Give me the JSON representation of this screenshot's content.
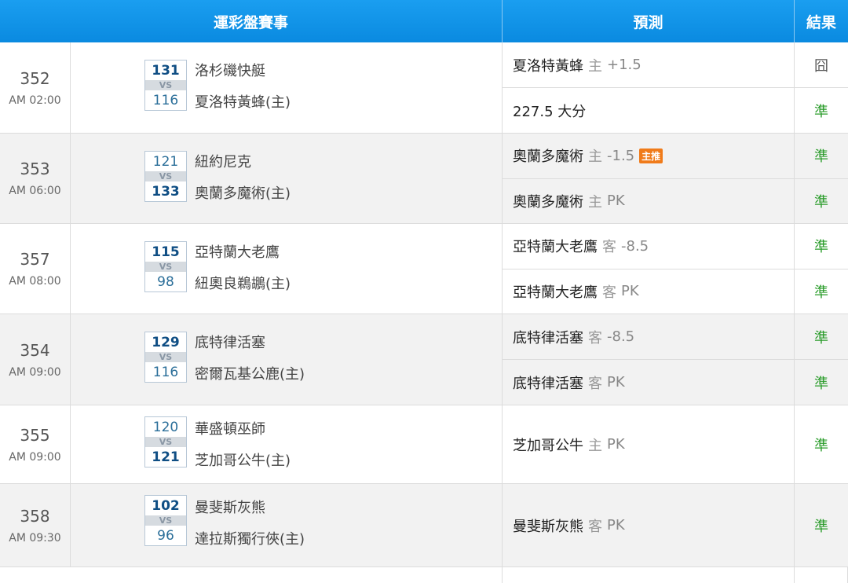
{
  "header": {
    "games": "運彩盤賽事",
    "prediction": "預測",
    "result": "結果"
  },
  "games": [
    {
      "id": "352",
      "time": "AM 02:00",
      "away": {
        "score": "131",
        "name": "洛杉磯快艇",
        "win": true
      },
      "home": {
        "score": "116",
        "name": "夏洛特黃蜂(主)",
        "win": false
      },
      "vs": "VS",
      "predictions": [
        {
          "team": "夏洛特黃蜂",
          "side": "主",
          "line": "+1.5",
          "badge": "",
          "result": "囧"
        },
        {
          "team": "227.5 大分",
          "side": "",
          "line": "",
          "badge": "",
          "result": "準"
        }
      ]
    },
    {
      "id": "353",
      "time": "AM 06:00",
      "away": {
        "score": "121",
        "name": "紐約尼克",
        "win": false
      },
      "home": {
        "score": "133",
        "name": "奧蘭多魔術(主)",
        "win": true
      },
      "vs": "VS",
      "predictions": [
        {
          "team": "奧蘭多魔術",
          "side": "主",
          "line": "-1.5",
          "badge": "主推",
          "result": "準"
        },
        {
          "team": "奧蘭多魔術",
          "side": "主",
          "line": "PK",
          "badge": "",
          "result": "準"
        }
      ]
    },
    {
      "id": "357",
      "time": "AM 08:00",
      "away": {
        "score": "115",
        "name": "亞特蘭大老鷹",
        "win": true
      },
      "home": {
        "score": "98",
        "name": "紐奧良鵜鶘(主)",
        "win": false
      },
      "vs": "VS",
      "predictions": [
        {
          "team": "亞特蘭大老鷹",
          "side": "客",
          "line": "-8.5",
          "badge": "",
          "result": "準"
        },
        {
          "team": "亞特蘭大老鷹",
          "side": "客",
          "line": "PK",
          "badge": "",
          "result": "準"
        }
      ]
    },
    {
      "id": "354",
      "time": "AM 09:00",
      "away": {
        "score": "129",
        "name": "底特律活塞",
        "win": true
      },
      "home": {
        "score": "116",
        "name": "密爾瓦基公鹿(主)",
        "win": false
      },
      "vs": "VS",
      "predictions": [
        {
          "team": "底特律活塞",
          "side": "客",
          "line": "-8.5",
          "badge": "",
          "result": "準"
        },
        {
          "team": "底特律活塞",
          "side": "客",
          "line": "PK",
          "badge": "",
          "result": "準"
        }
      ]
    },
    {
      "id": "355",
      "time": "AM 09:00",
      "away": {
        "score": "120",
        "name": "華盛頓巫師",
        "win": false
      },
      "home": {
        "score": "121",
        "name": "芝加哥公牛(主)",
        "win": true
      },
      "vs": "VS",
      "predictions": [
        {
          "team": "芝加哥公牛",
          "side": "主",
          "line": "PK",
          "badge": "",
          "result": "準"
        }
      ]
    },
    {
      "id": "358",
      "time": "AM 09:30",
      "away": {
        "score": "102",
        "name": "曼斐斯灰熊",
        "win": true
      },
      "home": {
        "score": "96",
        "name": "達拉斯獨行俠(主)",
        "win": false
      },
      "vs": "VS",
      "predictions": [
        {
          "team": "曼斐斯灰熊",
          "side": "客",
          "line": "PK",
          "badge": "",
          "result": "準"
        }
      ]
    }
  ],
  "colors": {
    "header_bg": "#1a9ef0",
    "hit": "#2a9c2a",
    "badge": "#f07b1a"
  }
}
